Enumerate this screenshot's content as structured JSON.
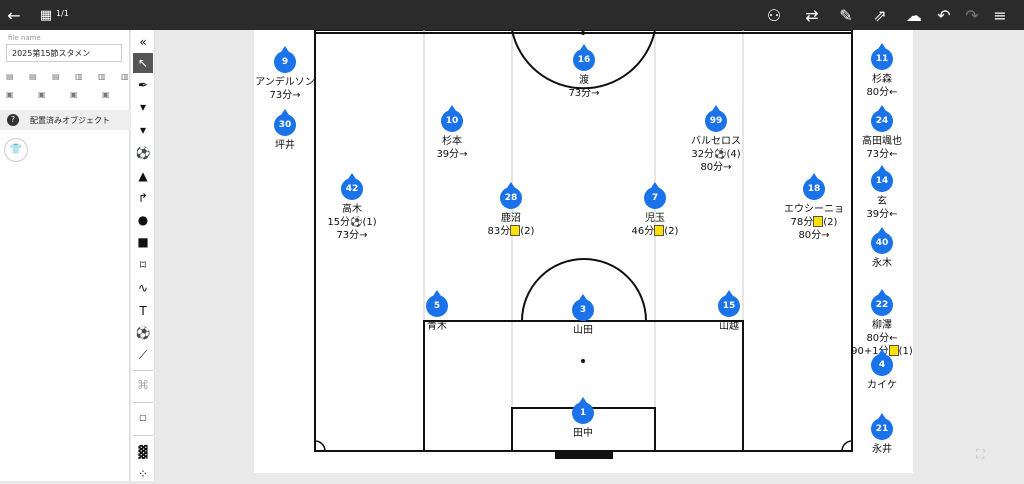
{
  "topbar": {
    "page_indicator": "1/1",
    "icons": [
      "back-arrow-icon",
      "calendar-icon",
      "team-icon",
      "substitution-icon",
      "edit-icon",
      "share-icon",
      "cloud-upload-icon",
      "undo-icon",
      "redo-icon",
      "menu-icon"
    ]
  },
  "left_panel": {
    "file_label": "file name",
    "file_name": "2025第15節スタメン",
    "objects_header": "配置済みオブジェクト"
  },
  "toolbar": {
    "tools": [
      "collapse",
      "select",
      "pen",
      "shirt-white",
      "shirt-black",
      "ball",
      "cone",
      "arrow",
      "circle",
      "square",
      "polygon",
      "curve",
      "text",
      "ball-outline",
      "ruler",
      "team-off",
      "offside",
      "formation",
      "dots"
    ]
  },
  "players_on_field": [
    {
      "number": "16",
      "name": "渡",
      "note1": "73分→",
      "note2": ""
    },
    {
      "number": "10",
      "name": "杉本",
      "note1": "39分→",
      "note2": ""
    },
    {
      "number": "99",
      "name": "バルセロス",
      "note1": "32分⚽(4)",
      "note2": "80分→"
    },
    {
      "number": "42",
      "name": "高木",
      "note1": "15分⚽(1)",
      "note2": "73分→"
    },
    {
      "number": "28",
      "name": "鹿沼",
      "note1": "83分",
      "note1_card": true,
      "note1_suffix": "(2)",
      "note2": ""
    },
    {
      "number": "7",
      "name": "児玉",
      "note1": "46分",
      "note1_card": true,
      "note1_suffix": "(2)",
      "note2": ""
    },
    {
      "number": "18",
      "name": "エウシーニョ",
      "note1": "78分",
      "note1_card": true,
      "note1_suffix": "(2)",
      "note2": "80分→"
    },
    {
      "number": "5",
      "name": "青木",
      "note1": "",
      "note2": ""
    },
    {
      "number": "3",
      "name": "山田",
      "note1": "",
      "note2": ""
    },
    {
      "number": "15",
      "name": "山越",
      "note1": "",
      "note2": ""
    },
    {
      "number": "1",
      "name": "田中",
      "note1": "",
      "note2": ""
    }
  ],
  "left_bench": [
    {
      "number": "9",
      "name": "アンデルソン",
      "note1": "73分→"
    },
    {
      "number": "30",
      "name": "坪井",
      "note1": ""
    }
  ],
  "right_bench": [
    {
      "number": "11",
      "name": "杉森",
      "note1": "80分←"
    },
    {
      "number": "24",
      "name": "高田颯也",
      "note1": "73分←"
    },
    {
      "number": "14",
      "name": "玄",
      "note1": "39分←"
    },
    {
      "number": "40",
      "name": "永木",
      "note1": ""
    },
    {
      "number": "22",
      "name": "柳澤",
      "note1": "80分←",
      "note2": "90+1分",
      "note2_card": true,
      "note2_suffix": "(1)"
    },
    {
      "number": "4",
      "name": "カイケ",
      "note1": ""
    },
    {
      "number": "21",
      "name": "永井",
      "note1": ""
    }
  ],
  "colors": {
    "player_badge": "#1a73e8",
    "topbar": "#2b2b2b",
    "yellow_card": "#ffe100"
  }
}
